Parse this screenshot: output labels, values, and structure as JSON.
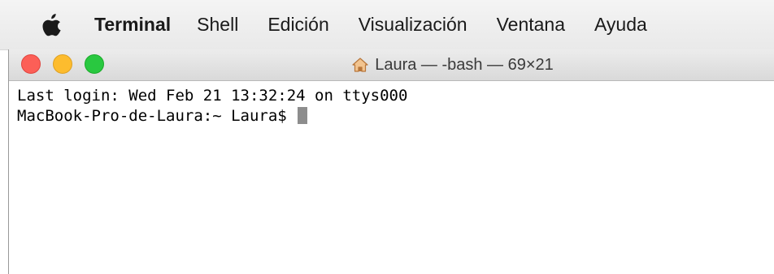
{
  "menubar": {
    "app_name": "Terminal",
    "items": [
      "Shell",
      "Edición",
      "Visualización",
      "Ventana",
      "Ayuda"
    ]
  },
  "window": {
    "title": "Laura — -bash — 69×21",
    "title_icon": "home-icon",
    "traffic_colors": {
      "close": "#fc5f57",
      "minimize": "#fdbc2e",
      "zoom": "#29c840"
    }
  },
  "terminal": {
    "login_line": "Last login: Wed Feb 21 13:32:24 on ttys000",
    "prompt": "MacBook-Pro-de-Laura:~ Laura$ "
  }
}
